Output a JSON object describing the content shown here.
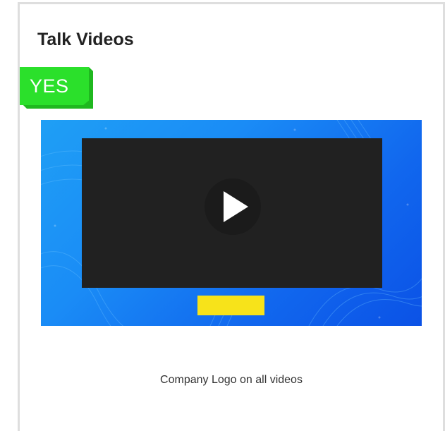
{
  "card": {
    "title": "Talk Videos",
    "badge": "YES",
    "caption": "Company Logo on all videos"
  },
  "icons": {
    "play": "play-icon"
  },
  "colors": {
    "badge_green": "#2be02b",
    "video_blue": "#1a8cf6",
    "screen_dark": "#212121",
    "logo_bar_yellow": "#f7e31a",
    "border_gray": "#dedede"
  }
}
